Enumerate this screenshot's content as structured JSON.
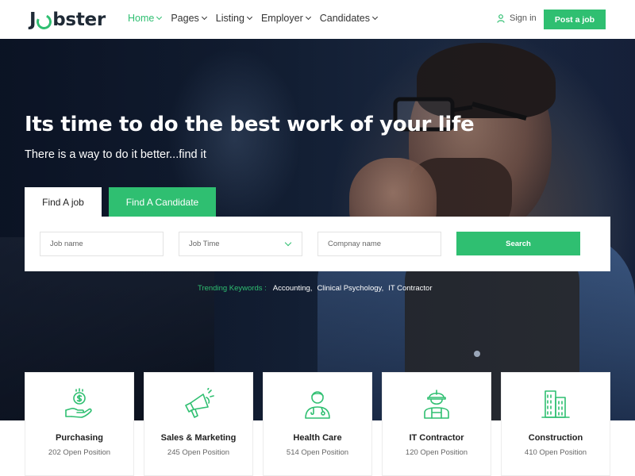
{
  "brand": {
    "logo_prefix": "J",
    "logo_suffix": "bster",
    "accent_color": "#2fbf71"
  },
  "nav": {
    "items": [
      {
        "label": "Home",
        "active": true
      },
      {
        "label": "Pages",
        "active": false
      },
      {
        "label": "Listing",
        "active": false
      },
      {
        "label": "Employer",
        "active": false
      },
      {
        "label": "Candidates",
        "active": false
      }
    ],
    "signin_label": "Sign in",
    "post_job_label": "Post a job"
  },
  "hero": {
    "title": "Its time to do the best work of your life",
    "subtitle": "There is a way to do it better...find it"
  },
  "search": {
    "tabs": [
      {
        "label": "Find A job",
        "active": true
      },
      {
        "label": "Find A Candidate",
        "active": false
      }
    ],
    "job_name_placeholder": "Job name",
    "job_time_value": "Job Time",
    "company_placeholder": "Compnay name",
    "search_label": "Search"
  },
  "trending": {
    "label": "Trending Keywords :",
    "keywords": [
      "Accounting,",
      "Clinical Psychology,",
      "IT Contractor"
    ]
  },
  "categories": [
    {
      "title": "Purchasing",
      "count": "202 Open Position",
      "icon": "money-hand-icon"
    },
    {
      "title": "Sales & Marketing",
      "count": "245 Open Position",
      "icon": "megaphone-icon"
    },
    {
      "title": "Health Care",
      "count": "514 Open Position",
      "icon": "doctor-icon"
    },
    {
      "title": "IT Contractor",
      "count": "120 Open Position",
      "icon": "worker-helmet-icon"
    },
    {
      "title": "Construction",
      "count": "410 Open Position",
      "icon": "buildings-icon"
    }
  ]
}
